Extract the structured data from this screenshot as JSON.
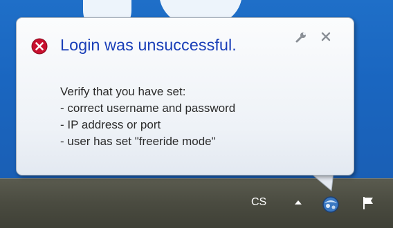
{
  "notification": {
    "title": "Login was unsuccessful.",
    "lines": [
      "Verify that you have set:",
      "- correct username and password",
      "- IP address or port",
      "- user has set \"freeride mode\""
    ],
    "icons": {
      "status": "error-icon",
      "options": "wrench-icon",
      "close": "close-icon"
    },
    "colors": {
      "title": "#1a3fb8",
      "error": "#c8102e"
    }
  },
  "taskbar": {
    "language": "CS",
    "tray_icons": [
      "show-hidden-icons-arrow",
      "app-tray-icon",
      "action-center-flag-icon"
    ]
  }
}
